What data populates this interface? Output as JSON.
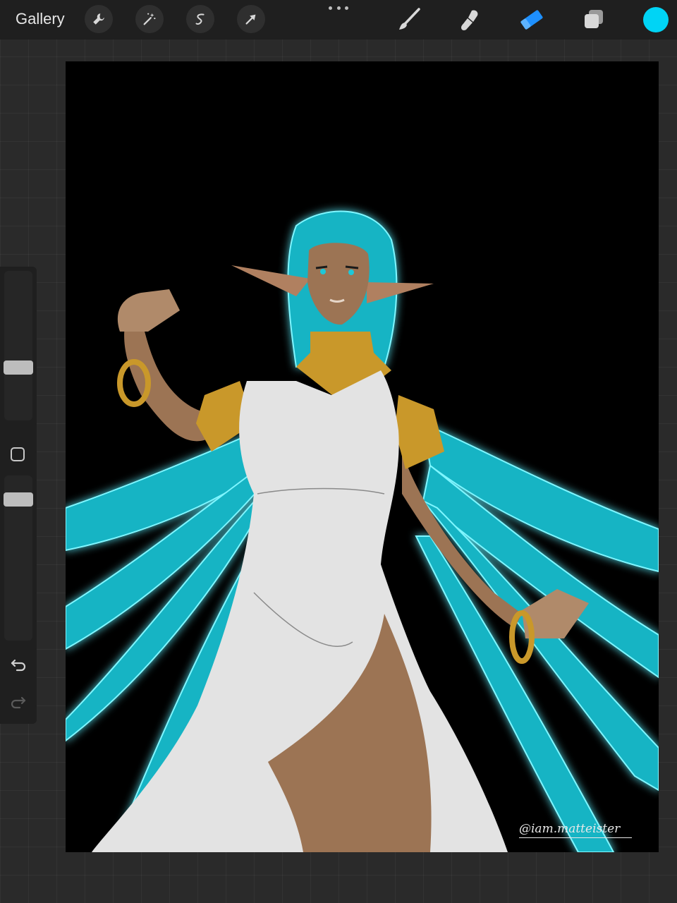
{
  "toolbar": {
    "gallery_label": "Gallery",
    "left_tools": [
      "wrench-icon",
      "magic-wand-icon",
      "selection-icon",
      "transform-arrow-icon"
    ],
    "right_tools": [
      "brush-icon",
      "smudge-icon",
      "eraser-icon",
      "layers-icon"
    ],
    "active_tool": "eraser-icon",
    "current_color": "#00d4f5"
  },
  "sidebar": {
    "brush_size_level": 0.6,
    "opacity_level": 0.25
  },
  "canvas": {
    "signature": "@iam.matteister"
  },
  "colors": {
    "hair": "#1ec8d8",
    "glow": "#00e5ff",
    "skin": "#9c7454",
    "dress": "#e3e3e3",
    "gold": "#c9982a",
    "accent_blue": "#1e90ff"
  }
}
